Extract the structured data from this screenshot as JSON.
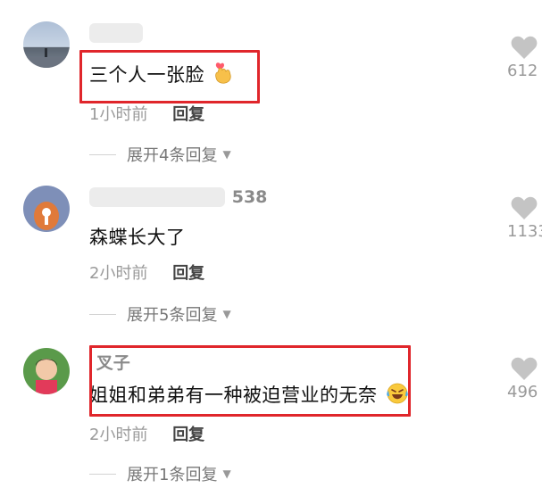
{
  "comments": [
    {
      "name": "",
      "text": "三个人一张脸",
      "emoji": "finger-heart-emoji",
      "time": "1小时前",
      "reply_label": "回复",
      "likes": "612",
      "expand_label": "展开4条回复"
    },
    {
      "name": "538",
      "text": "森蝶长大了",
      "emoji": "",
      "time": "2小时前",
      "reply_label": "回复",
      "likes": "1133",
      "expand_label": "展开5条回复"
    },
    {
      "name": "叉子",
      "text": "姐姐和弟弟有一种被迫营业的无奈",
      "emoji": "laughing-tears-emoji",
      "time": "2小时前",
      "reply_label": "回复",
      "likes": "496",
      "expand_label": "展开1条回复"
    }
  ],
  "colors": {
    "highlight_border": "#e0262b",
    "heart": "#c4c4c4",
    "meta_text": "#9a9a9a"
  }
}
